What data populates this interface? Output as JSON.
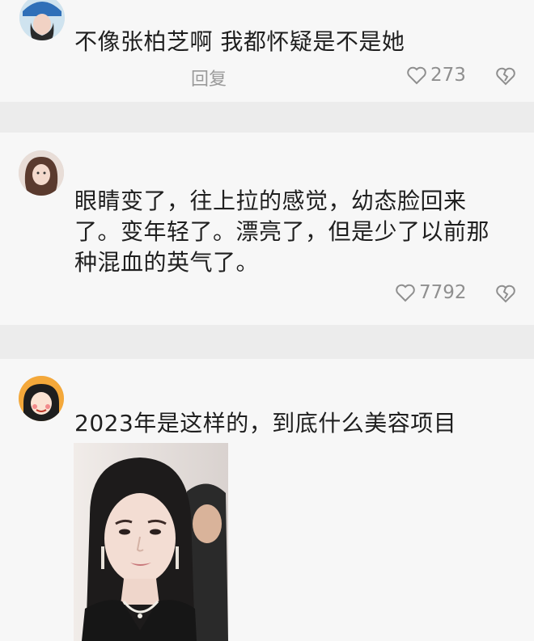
{
  "comments": [
    {
      "text": "不像张柏芝啊 我都怀疑是不是她",
      "reply_label": "回复",
      "likes": "273"
    },
    {
      "text": "眼睛变了，往上拉的感觉，幼态脸回来了。变年轻了。漂亮了，但是少了以前那种混血的英气了。",
      "likes": "7792"
    },
    {
      "text": "2023年是这样的，到底什么美容项目"
    }
  ],
  "icons": {
    "like": "heart-outline-icon",
    "dislike": "broken-heart-icon"
  },
  "colors": {
    "card_bg": "#f7f7f7",
    "page_bg": "#ececec",
    "text": "#1f1f1f",
    "meta": "#9a9a9a"
  }
}
